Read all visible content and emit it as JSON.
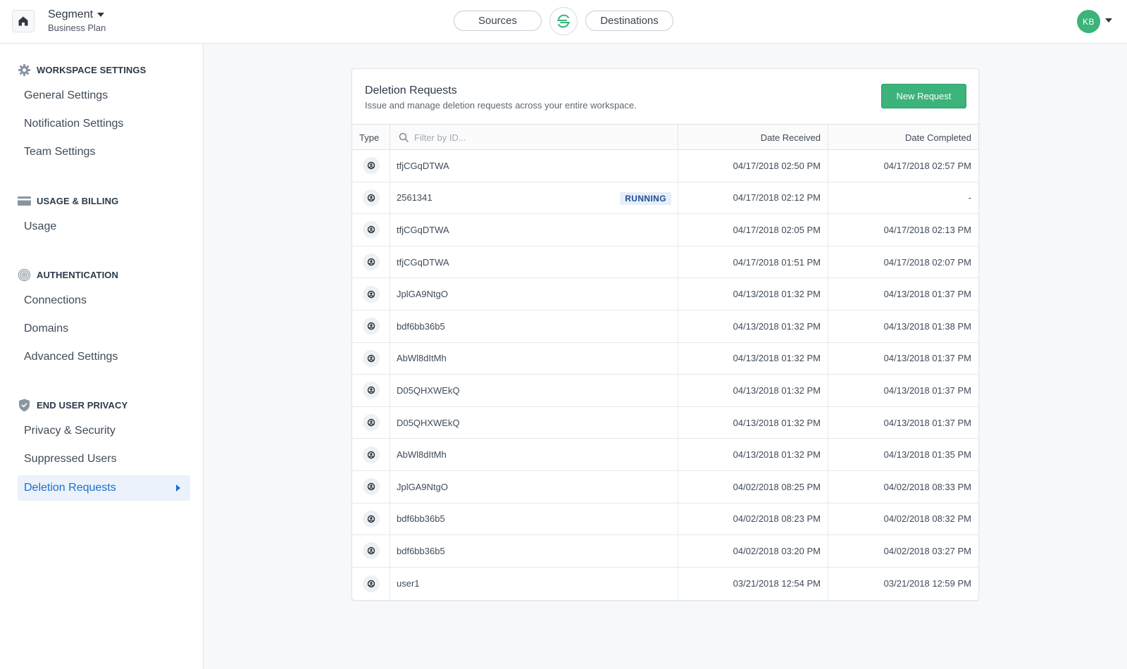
{
  "topbar": {
    "workspace_name": "Segment",
    "plan": "Business Plan",
    "sources_label": "Sources",
    "destinations_label": "Destinations",
    "avatar_initials": "KB",
    "avatar_color": "#3bb379"
  },
  "sidebar": {
    "sections": [
      {
        "title": "WORKSPACE SETTINGS",
        "icon": "gear-icon",
        "items": [
          "General Settings",
          "Notification Settings",
          "Team Settings"
        ]
      },
      {
        "title": "USAGE & BILLING",
        "icon": "credit-card-icon",
        "items": [
          "Usage"
        ]
      },
      {
        "title": "AUTHENTICATION",
        "icon": "fingerprint-icon",
        "items": [
          "Connections",
          "Domains",
          "Advanced Settings"
        ]
      },
      {
        "title": "END USER PRIVACY",
        "icon": "shield-icon",
        "items": [
          "Privacy & Security",
          "Suppressed Users",
          "Deletion Requests"
        ]
      }
    ],
    "active_item": "Deletion Requests"
  },
  "card": {
    "title": "Deletion Requests",
    "subtitle": "Issue and manage deletion requests across your entire workspace.",
    "new_button": "New Request"
  },
  "table": {
    "headers": {
      "type": "Type",
      "filter_placeholder": "Filter by ID...",
      "received": "Date Received",
      "completed": "Date Completed"
    },
    "rows": [
      {
        "id": "tfjCGqDTWA",
        "status": "",
        "received": "04/17/2018 02:50 PM",
        "completed": "04/17/2018 02:57 PM"
      },
      {
        "id": "2561341",
        "status": "RUNNING",
        "received": "04/17/2018 02:12 PM",
        "completed": "-"
      },
      {
        "id": "tfjCGqDTWA",
        "status": "",
        "received": "04/17/2018 02:05 PM",
        "completed": "04/17/2018 02:13 PM"
      },
      {
        "id": "tfjCGqDTWA",
        "status": "",
        "received": "04/17/2018 01:51 PM",
        "completed": "04/17/2018 02:07 PM"
      },
      {
        "id": "JplGA9NtgO",
        "status": "",
        "received": "04/13/2018 01:32 PM",
        "completed": "04/13/2018 01:37 PM"
      },
      {
        "id": "bdf6bb36b5",
        "status": "",
        "received": "04/13/2018 01:32 PM",
        "completed": "04/13/2018 01:38 PM"
      },
      {
        "id": "AbWl8dItMh",
        "status": "",
        "received": "04/13/2018 01:32 PM",
        "completed": "04/13/2018 01:37 PM"
      },
      {
        "id": "D05QHXWEkQ",
        "status": "",
        "received": "04/13/2018 01:32 PM",
        "completed": "04/13/2018 01:37 PM"
      },
      {
        "id": "D05QHXWEkQ",
        "status": "",
        "received": "04/13/2018 01:32 PM",
        "completed": "04/13/2018 01:37 PM"
      },
      {
        "id": "AbWl8dItMh",
        "status": "",
        "received": "04/13/2018 01:32 PM",
        "completed": "04/13/2018 01:35 PM"
      },
      {
        "id": "JplGA9NtgO",
        "status": "",
        "received": "04/02/2018 08:25 PM",
        "completed": "04/02/2018 08:33 PM"
      },
      {
        "id": "bdf6bb36b5",
        "status": "",
        "received": "04/02/2018 08:23 PM",
        "completed": "04/02/2018 08:32 PM"
      },
      {
        "id": "bdf6bb36b5",
        "status": "",
        "received": "04/02/2018 03:20 PM",
        "completed": "04/02/2018 03:27 PM"
      },
      {
        "id": "user1",
        "status": "",
        "received": "03/21/2018 12:54 PM",
        "completed": "03/21/2018 12:59 PM"
      }
    ]
  },
  "colors": {
    "accent_green": "#3bb37a",
    "active_blue": "#1b6fcf",
    "badge_bg": "#e6eef9"
  }
}
